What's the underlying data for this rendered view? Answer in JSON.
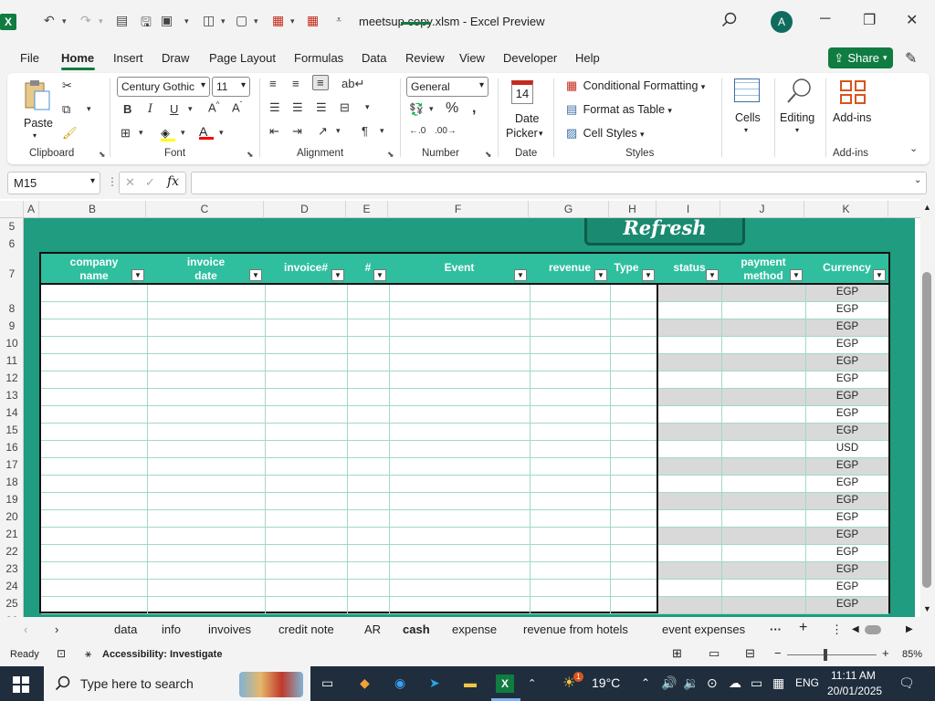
{
  "window": {
    "title": "meetsup copy.xlsm  -  Excel Preview",
    "avatar_initial": "A"
  },
  "menu": {
    "tabs": [
      "File",
      "Home",
      "Insert",
      "Draw",
      "Page Layout",
      "Formulas",
      "Data",
      "Review",
      "View",
      "Developer",
      "Help"
    ],
    "active": "Home",
    "share_label": "Share"
  },
  "ribbon": {
    "groups": [
      "Clipboard",
      "Font",
      "Alignment",
      "Number",
      "Date",
      "Styles",
      "Add-ins"
    ],
    "paste_label": "Paste",
    "font_name": "Century Gothic",
    "font_size": "11",
    "number_format": "General",
    "date_picker_line1": "Date",
    "date_picker_line2": "Picker",
    "date_icon_number": "14",
    "conditional_formatting": "Conditional Formatting",
    "format_as_table": "Format as Table",
    "cell_styles": "Cell Styles",
    "cells_label": "Cells",
    "editing_label": "Editing",
    "addins_label": "Add-ins"
  },
  "formula_bar": {
    "name_box": "M15",
    "fx_label": "fx",
    "formula": ""
  },
  "sheet": {
    "columns": [
      "A",
      "B",
      "C",
      "D",
      "E",
      "F",
      "G",
      "H",
      "I",
      "J",
      "K"
    ],
    "rows": [
      "5",
      "6",
      "7",
      "8",
      "9",
      "10",
      "11",
      "12",
      "13",
      "14",
      "15",
      "16",
      "17",
      "18",
      "19",
      "20",
      "21",
      "22",
      "23",
      "24",
      "25",
      "26"
    ],
    "refresh_label": "Refresh",
    "headers": [
      "company name",
      "invoice date",
      "invoice#",
      "#",
      "Event",
      "revenue",
      "Type",
      "status",
      "payment method",
      "Currency"
    ],
    "currency": [
      "EGP",
      "EGP",
      "EGP",
      "EGP",
      "EGP",
      "EGP",
      "EGP",
      "EGP",
      "EGP",
      "USD",
      "EGP",
      "EGP",
      "EGP",
      "EGP",
      "EGP",
      "EGP",
      "EGP",
      "EGP",
      "EGP"
    ]
  },
  "tabs": {
    "sheets": [
      "data",
      "info",
      "invoives",
      "credit note",
      "AR",
      "cash",
      "expense",
      "revenue from hotels",
      "event expenses"
    ],
    "active": "cash"
  },
  "status": {
    "ready": "Ready",
    "accessibility": "Accessibility: Investigate",
    "zoom": "85%"
  },
  "taskbar": {
    "search_placeholder": "Type here to search",
    "weather": "19°C",
    "language": "ENG",
    "time": "11:11 AM",
    "date": "20/01/2025",
    "notification_count": "1"
  },
  "colors": {
    "accent": "#107c41",
    "sheet_green": "#209c80",
    "header_green": "#2fbf9f",
    "taskbar": "#1f2d3d"
  }
}
